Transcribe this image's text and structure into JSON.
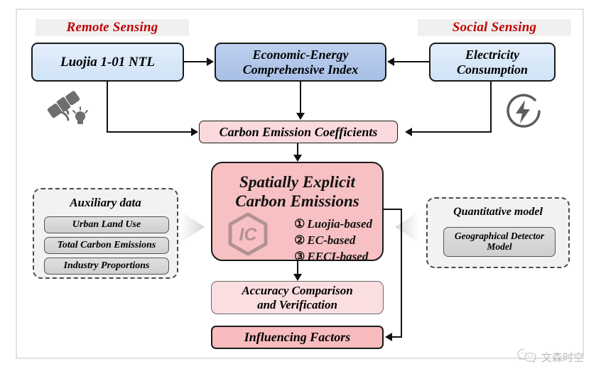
{
  "figure": {
    "sections": [
      {
        "id": "remote-sensing",
        "label": "Remote Sensing"
      },
      {
        "id": "social-sensing",
        "label": "Social Sensing"
      }
    ],
    "nodes": {
      "luojia": "Luojia 1-01 NTL",
      "eeci_line1": "Economic-Energy",
      "eeci_line2": "Comprehensive Index",
      "electricity_line1": "Electricity",
      "electricity_line2": "Consumption",
      "coefficients": "Carbon Emission Coefficients",
      "central_line1": "Spatially  Explicit",
      "central_line2": "Carbon Emissions",
      "accuracy_line1": "Accuracy Comparison",
      "accuracy_line2": "and Verification",
      "influencing": "Influencing Factors"
    },
    "central_items": [
      {
        "num": "①",
        "label": "Luojia-based"
      },
      {
        "num": "②",
        "label": "EC-based"
      },
      {
        "num": "③",
        "label": "EECI-based"
      }
    ],
    "central_logo_text": "IC",
    "auxiliary": {
      "title": "Auxiliary data",
      "items": [
        "Urban Land Use",
        "Total Carbon Emissions",
        "Industry Proportions"
      ]
    },
    "quantitative": {
      "title": "Quantitative model",
      "items_line1": "Geographical Detector",
      "items_line2": "Model"
    },
    "icons": [
      {
        "id": "satellite-icon",
        "name": "satellite-icon"
      },
      {
        "id": "lightbulb-icon",
        "name": "lightbulb-icon"
      },
      {
        "id": "electricity-icon",
        "name": "electricity-icon"
      }
    ],
    "watermark": {
      "text": "文森时空",
      "icon": "wechat-icon"
    },
    "colors": {
      "accent_red": "#c00000",
      "blue_light": "#d6e6f7",
      "blue_mid": "#aec4e8",
      "pink_light": "#fbd9dc",
      "pink_mid": "#f8bcbe",
      "pink_central": "#f7c0c2",
      "panel_grey": "#f2f2f2",
      "chip_grey": "#d6d6d6",
      "line": "#111111"
    }
  }
}
